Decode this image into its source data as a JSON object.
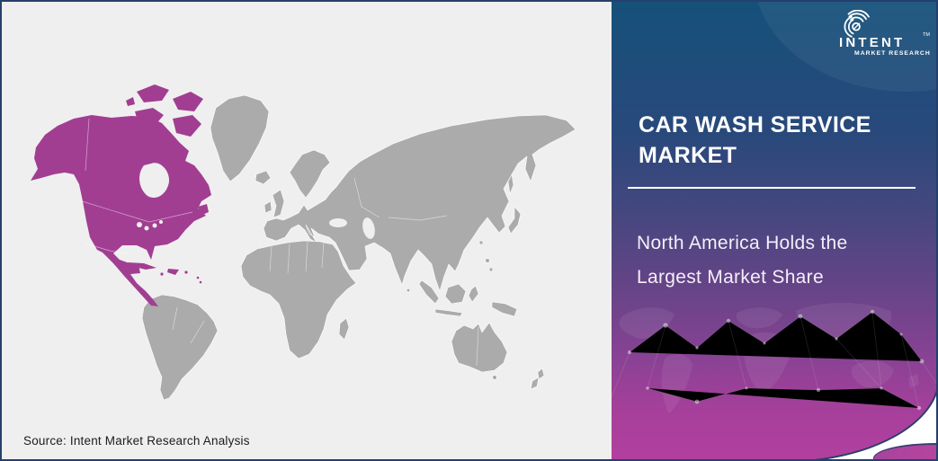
{
  "brand": {
    "name": "INTENT",
    "tagline": "MARKET RESEARCH",
    "trademark": "TM"
  },
  "panel": {
    "title": "CAR WASH SERVICE MARKET",
    "subtitle": "North America Holds the Largest Market Share"
  },
  "map": {
    "highlighted_region": "North America",
    "highlight_color": "#a13e92",
    "land_color": "#ababab",
    "water_color": "#f0efef"
  },
  "footer": {
    "source": "Source: Intent Market Research Analysis"
  },
  "colors": {
    "panel_gradient_top": "#15517a",
    "panel_gradient_bottom": "#b23f9f",
    "frame_border": "#24406b"
  }
}
